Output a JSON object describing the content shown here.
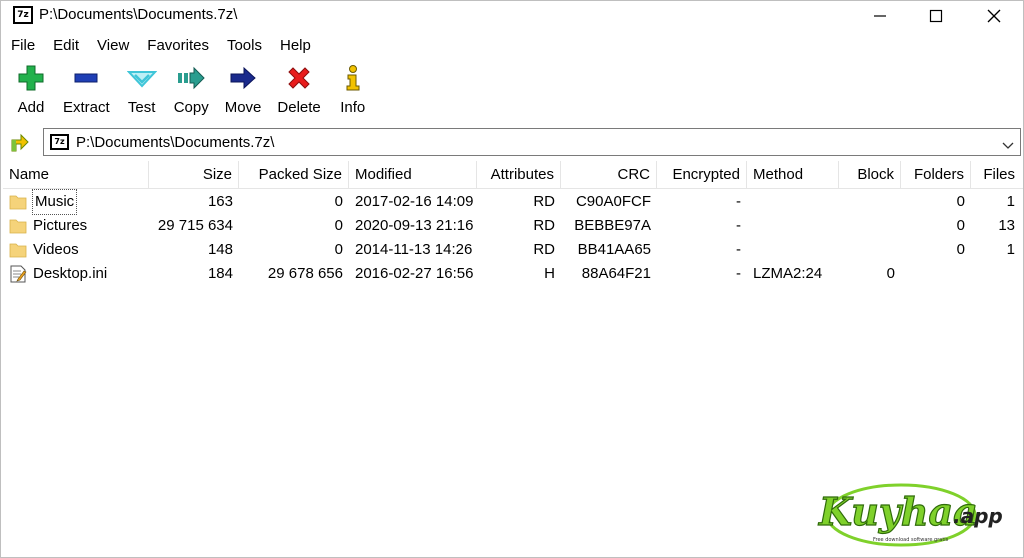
{
  "window": {
    "title": "P:\\Documents\\Documents.7z\\",
    "app_icon_text": "7z"
  },
  "menu": [
    "File",
    "Edit",
    "View",
    "Favorites",
    "Tools",
    "Help"
  ],
  "toolbar": [
    {
      "label": "Add",
      "icon": "add-icon"
    },
    {
      "label": "Extract",
      "icon": "extract-icon"
    },
    {
      "label": "Test",
      "icon": "test-icon"
    },
    {
      "label": "Copy",
      "icon": "copy-icon"
    },
    {
      "label": "Move",
      "icon": "move-icon"
    },
    {
      "label": "Delete",
      "icon": "delete-icon"
    },
    {
      "label": "Info",
      "icon": "info-icon"
    }
  ],
  "address": {
    "icon_text": "7z",
    "path": "P:\\Documents\\Documents.7z\\"
  },
  "columns": [
    "Name",
    "Size",
    "Packed Size",
    "Modified",
    "Attributes",
    "CRC",
    "Encrypted",
    "Method",
    "Block",
    "Folders",
    "Files"
  ],
  "rows": [
    {
      "type": "folder",
      "name": "Music",
      "size": "163",
      "packed": "0",
      "modified": "2017-02-16 14:09",
      "attributes": "RD",
      "crc": "C90A0FCF",
      "encrypted": "-",
      "method": "",
      "block": "",
      "folders": "0",
      "files": "1"
    },
    {
      "type": "folder",
      "name": "Pictures",
      "size": "29 715 634",
      "packed": "0",
      "modified": "2020-09-13 21:16",
      "attributes": "RD",
      "crc": "BEBBE97A",
      "encrypted": "-",
      "method": "",
      "block": "",
      "folders": "0",
      "files": "13"
    },
    {
      "type": "folder",
      "name": "Videos",
      "size": "148",
      "packed": "0",
      "modified": "2014-11-13 14:26",
      "attributes": "RD",
      "crc": "BB41AA65",
      "encrypted": "-",
      "method": "",
      "block": "",
      "folders": "0",
      "files": "1"
    },
    {
      "type": "file",
      "name": "Desktop.ini",
      "size": "184",
      "packed": "29 678 656",
      "modified": "2016-02-27 16:56",
      "attributes": "H",
      "crc": "88A64F21",
      "encrypted": "-",
      "method": "LZMA2:24",
      "block": "0",
      "folders": "",
      "files": ""
    }
  ],
  "watermark": {
    "text": "Kuyhaa",
    "suffix": ".app",
    "tagline": "Free download software gratis"
  },
  "colors": {
    "folder": "#f5d37a",
    "add_green": "#22b14c",
    "extract_blue": "#1f3fb5",
    "test_cyan": "#3fc5d8",
    "copy_teal": "#2a9d8f",
    "move_navy": "#1a2a8c",
    "delete_red": "#e81c1c",
    "info_yellow": "#f2c200",
    "watermark_green": "#7fd12b"
  }
}
